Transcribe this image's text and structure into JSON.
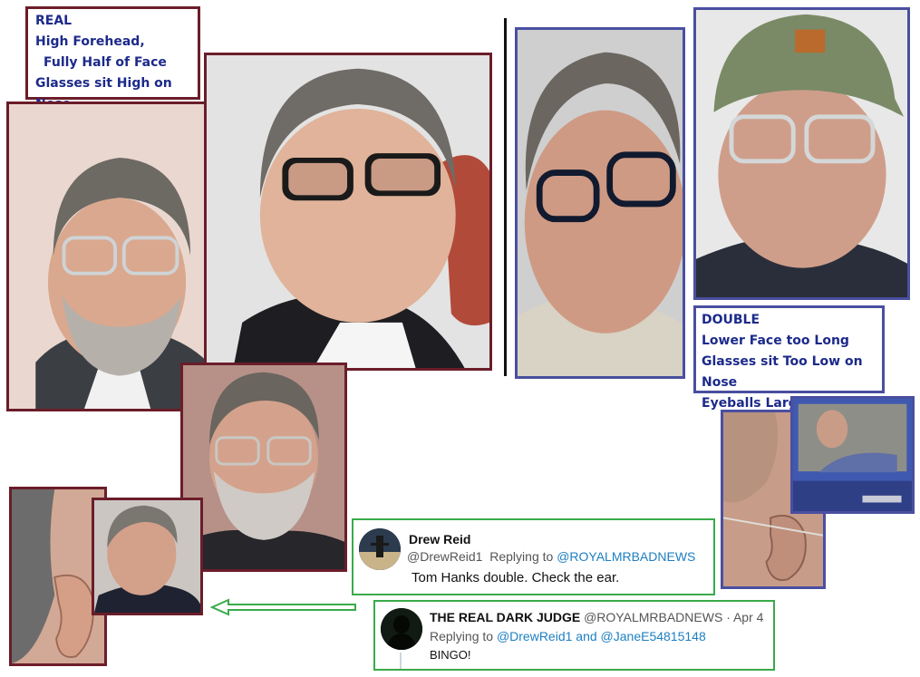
{
  "real_label": {
    "line1": "REAL",
    "line2": "High Forehead,",
    "line3": "Fully Half of Face",
    "line4": "Glasses sit High on Nose"
  },
  "double_label": {
    "line1": "DOUBLE",
    "line2": "Lower Face too Long",
    "line3": "Glasses sit Too Low on Nose",
    "line4": "Eyeballs Larger"
  },
  "tweet1": {
    "name": "Drew Reid",
    "handle": "@DrewReid1",
    "replying_prefix": "Replying to",
    "replying_to": "@ROYALMRBADNEWS",
    "text": "Tom Hanks double.  Check the ear."
  },
  "tweet2": {
    "name": "THE REAL DARK JUDGE",
    "handle": "@ROYALMRBADNEWS",
    "date": "· Apr 4",
    "replying_prefix": "Replying to",
    "replying_to": "@DrewReid1 and @JaneE54815148",
    "text": "BINGO!"
  },
  "colors": {
    "real_border": "#6b1d2a",
    "double_border": "#4a4fa0",
    "label_text": "#1c2a8a",
    "tweet_border": "#3aaa4a",
    "link": "#1d7fc2",
    "arrow": "#3aaa4a"
  }
}
